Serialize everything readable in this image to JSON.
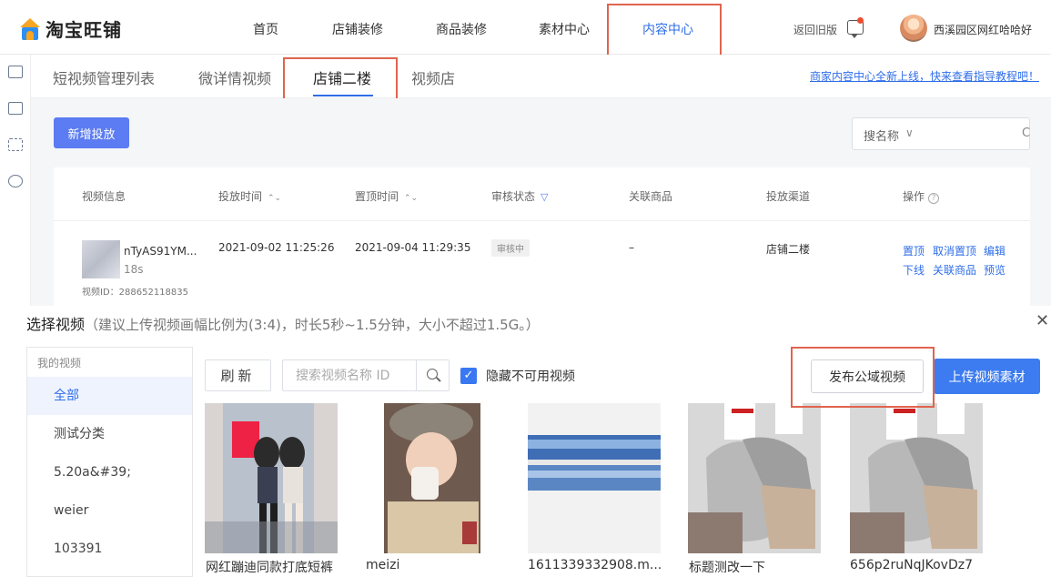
{
  "header": {
    "logo_text": "淘宝旺铺",
    "nav": [
      "首页",
      "店铺装修",
      "商品装修",
      "素材中心",
      "内容中心"
    ],
    "active_nav": "内容中心",
    "back_link": "返回旧版",
    "shop_name": "西溪园区网红哈哈好"
  },
  "subtabs": {
    "items": [
      "短视频管理列表",
      "微详情视频",
      "店铺二楼",
      "视频店"
    ],
    "active": "店铺二楼",
    "guide_link": "商家内容中心全新上线，快来查看指导教程吧！"
  },
  "toolbar": {
    "add_button": "新增投放",
    "search_label": "搜名称",
    "search_chevron": "∨",
    "search_icon_glyph": "C"
  },
  "table": {
    "headers": [
      "视频信息",
      "投放时间",
      "置顶时间",
      "审核状态",
      "关联商品",
      "投放渠道",
      "操作"
    ],
    "sort_glyph": "⌃⌄",
    "filter_glyph": "▽",
    "help_glyph": "?",
    "row": {
      "title": "nTyAS91YM...",
      "duration": "18s",
      "video_id": "视频ID：288652118835",
      "publish_time": "2021-09-02 11:25:26",
      "pin_time": "2021-09-04 11:29:35",
      "status": "审核中",
      "goods": "–",
      "channel": "店铺二楼",
      "actions": [
        "置顶",
        "取消置顶",
        "编辑",
        "下线",
        "关联商品",
        "预览"
      ]
    }
  },
  "modal": {
    "title": "选择视频",
    "hint": "（建议上传视频画幅比例为(3:4)，时长5秒~1.5分钟，大小不超过1.5G。）",
    "close_glyph": "✕",
    "sidebar": {
      "heading": "我的视频",
      "items": [
        "全部",
        "测试分类",
        "5.20a&#39;",
        "weier",
        "103391"
      ],
      "active": "全部"
    },
    "refresh_button": "刷新",
    "search_placeholder": "搜索视频名称 ID",
    "hide_unavailable_label": "隐藏不可用视频",
    "check_glyph": "✓",
    "publish_public_button": "发布公域视频",
    "upload_button": "上传视频素材",
    "videos": [
      {
        "caption": "网红蹦迪同款打底短裤"
      },
      {
        "caption": "meizi"
      },
      {
        "caption": "1611339332908.m..."
      },
      {
        "caption": "标题测改一下"
      },
      {
        "caption": "656p2ruNqJKovDz7"
      }
    ]
  },
  "colors": {
    "accent": "#2f6ee8",
    "primary_button": "#5b7cf2",
    "highlight_box": "#e0644f"
  }
}
